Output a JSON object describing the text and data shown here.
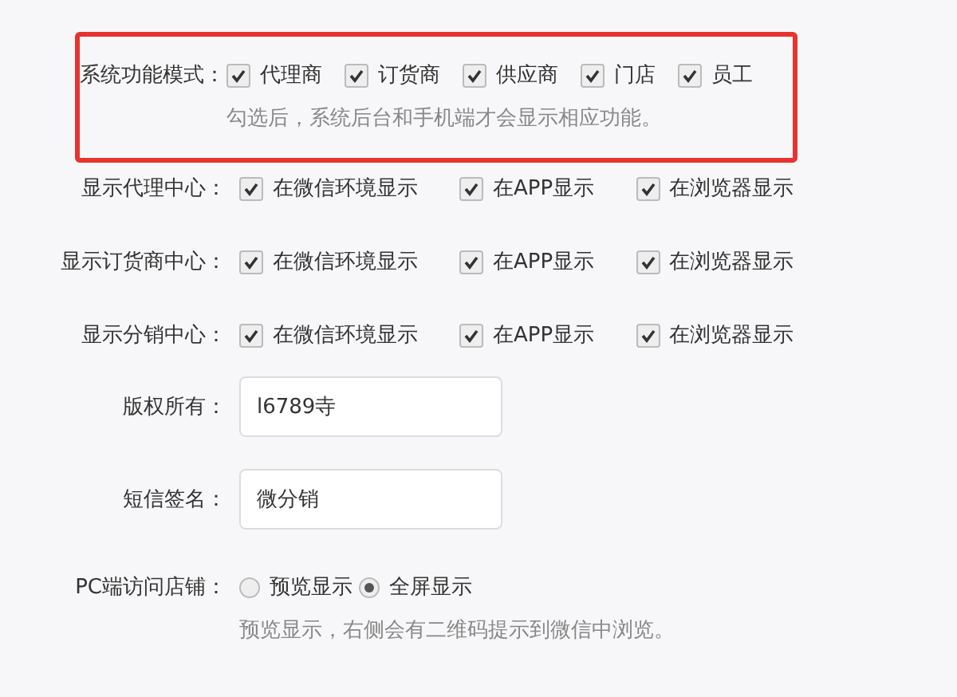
{
  "rows": [
    {
      "kind": "checks",
      "label": "系统功能模式：",
      "highlighted": true,
      "options": [
        {
          "label": "代理商",
          "checked": true
        },
        {
          "label": "订货商",
          "checked": true
        },
        {
          "label": "供应商",
          "checked": true
        },
        {
          "label": "门店",
          "checked": true
        },
        {
          "label": "员工",
          "checked": true
        }
      ],
      "hint": "勾选后，系统后台和手机端才会显示相应功能。"
    },
    {
      "kind": "checks",
      "label": "显示代理中心：",
      "highlighted": false,
      "options": [
        {
          "label": "在微信环境显示",
          "checked": true
        },
        {
          "label": "在APP显示",
          "checked": true
        },
        {
          "label": "在浏览器显示",
          "checked": true
        }
      ]
    },
    {
      "kind": "checks",
      "label": "显示订货商中心：",
      "highlighted": false,
      "options": [
        {
          "label": "在微信环境显示",
          "checked": true
        },
        {
          "label": "在APP显示",
          "checked": true
        },
        {
          "label": "在浏览器显示",
          "checked": true
        }
      ]
    },
    {
      "kind": "checks",
      "label": "显示分销中心：",
      "highlighted": false,
      "options": [
        {
          "label": "在微信环境显示",
          "checked": true
        },
        {
          "label": "在APP显示",
          "checked": true
        },
        {
          "label": "在浏览器显示",
          "checked": true
        }
      ]
    },
    {
      "kind": "text",
      "label": "版权所有：",
      "highlighted": false,
      "value": "l6789寺"
    },
    {
      "kind": "text",
      "label": "短信签名：",
      "highlighted": false,
      "value": "微分销"
    },
    {
      "kind": "radios",
      "label": "PC端访问店铺：",
      "highlighted": false,
      "options": [
        {
          "label": "预览显示",
          "selected": false
        },
        {
          "label": "全屏显示",
          "selected": true
        }
      ],
      "hint": "预览显示，右侧会有二维码提示到微信中浏览。"
    }
  ]
}
